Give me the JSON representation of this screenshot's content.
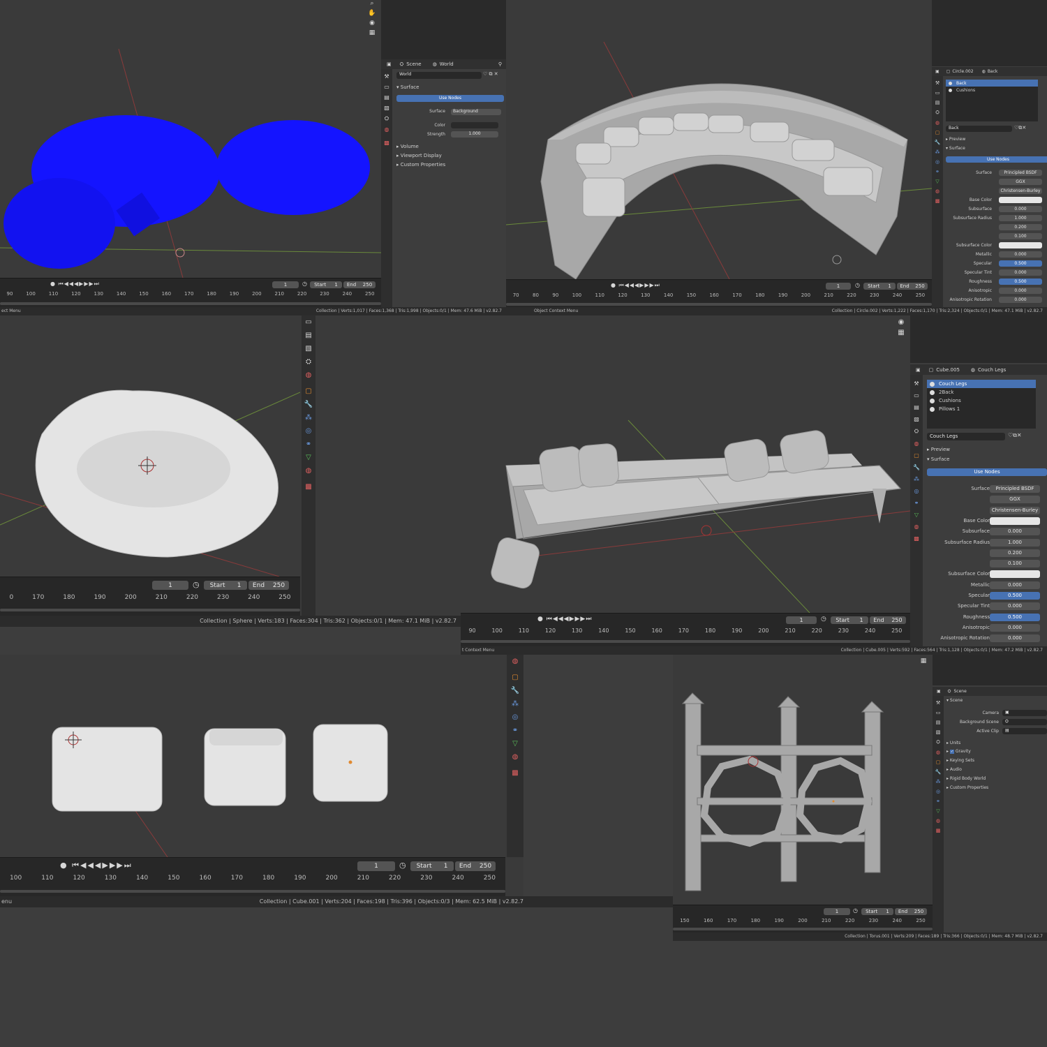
{
  "colors": {
    "blue_mesh": "#1414ff",
    "accent": "#4772b3",
    "mesh_grey": "#a8a8a8",
    "mesh_white": "#e4e4e4"
  },
  "p1": {
    "frame": "1",
    "start_label": "Start",
    "start": "1",
    "end_label": "End",
    "end": "250",
    "ruler": [
      "90",
      "100",
      "110",
      "120",
      "130",
      "140",
      "150",
      "160",
      "170",
      "180",
      "190",
      "200",
      "210",
      "220",
      "230",
      "240",
      "250"
    ],
    "props": {
      "scene_tab": "Scene",
      "world_tab": "World",
      "world_name": "World",
      "surface_section": "Surface",
      "use_nodes": "Use Nodes",
      "surface_label": "Surface",
      "surface_value": "Background",
      "color_label": "Color",
      "strength_label": "Strength",
      "strength_value": "1.000",
      "volume": "Volume",
      "viewport_display": "Viewport Display",
      "custom_properties": "Custom Properties"
    },
    "status_left": "ect Menu",
    "status": "Collection | Verts:1,017 | Faces:1,368 | Tris:1,998 | Objects:0/1 | Mem: 47.6 MiB | v2.82.7"
  },
  "p2": {
    "frame": "1",
    "start_label": "Start",
    "start": "1",
    "end_label": "End",
    "end": "250",
    "ruler": [
      "70",
      "80",
      "90",
      "100",
      "110",
      "120",
      "130",
      "140",
      "150",
      "160",
      "170",
      "180",
      "190",
      "200",
      "210",
      "220",
      "230",
      "240",
      "250"
    ],
    "props": {
      "object": "Circle.002",
      "material": "Back",
      "slots": [
        "Back",
        "Cushions"
      ],
      "material_name": "Back",
      "preview": "Preview",
      "surface_section": "Surface",
      "use_nodes": "Use Nodes",
      "rows": [
        {
          "label": "Surface",
          "value": "Principled BSDF",
          "kind": "plain"
        },
        {
          "label": "",
          "value": "GGX",
          "kind": "plain"
        },
        {
          "label": "",
          "value": "Christensen-Burley",
          "kind": "plain"
        },
        {
          "label": "Base Color",
          "value": "",
          "kind": "white"
        },
        {
          "label": "Subsurface",
          "value": "0.000",
          "kind": "plain"
        },
        {
          "label": "Subsurface Radius",
          "value": "1.000",
          "kind": "plain"
        },
        {
          "label": "",
          "value": "0.200",
          "kind": "plain"
        },
        {
          "label": "",
          "value": "0.100",
          "kind": "plain"
        },
        {
          "label": "Subsurface Color",
          "value": "",
          "kind": "white"
        },
        {
          "label": "Metallic",
          "value": "0.000",
          "kind": "plain"
        },
        {
          "label": "Specular",
          "value": "0.500",
          "kind": "blue"
        },
        {
          "label": "Specular Tint",
          "value": "0.000",
          "kind": "plain"
        },
        {
          "label": "Roughness",
          "value": "0.500",
          "kind": "blue"
        },
        {
          "label": "Anisotropic",
          "value": "0.000",
          "kind": "plain"
        },
        {
          "label": "Anisotropic Rotation",
          "value": "0.000",
          "kind": "plain"
        }
      ]
    },
    "status_left": "Object Context Menu",
    "status": "Collection | Circle.002 | Verts:1,222 | Faces:1,170 | Tris:2,324 | Objects:0/1 | Mem: 47.1 MiB | v2.82.7"
  },
  "p3": {
    "frame": "1",
    "start_label": "Start",
    "start": "1",
    "end_label": "End",
    "end": "250",
    "ruler": [
      "0",
      "170",
      "180",
      "190",
      "200",
      "210",
      "220",
      "230",
      "240",
      "250"
    ],
    "status": "Collection | Sphere | Verts:183 | Faces:304 | Tris:362 | Objects:0/1 | Mem: 47.1 MiB | v2.82.7"
  },
  "p4": {
    "frame": "1",
    "start_label": "Start",
    "start": "1",
    "end_label": "End",
    "end": "250",
    "ruler": [
      "90",
      "100",
      "110",
      "120",
      "130",
      "140",
      "150",
      "160",
      "170",
      "180",
      "190",
      "200",
      "210",
      "220",
      "230",
      "240",
      "250"
    ],
    "props": {
      "object": "Cube.005",
      "material": "Couch Legs",
      "slots": [
        "Couch Legs",
        "2Back",
        "Cushions",
        "Pillows 1"
      ],
      "material_name": "Couch Legs",
      "preview": "Preview",
      "surface_section": "Surface",
      "use_nodes": "Use Nodes",
      "rows": [
        {
          "label": "Surface",
          "value": "Principled BSDF",
          "kind": "plain"
        },
        {
          "label": "",
          "value": "GGX",
          "kind": "plain"
        },
        {
          "label": "",
          "value": "Christensen-Burley",
          "kind": "plain"
        },
        {
          "label": "Base Color",
          "value": "",
          "kind": "white"
        },
        {
          "label": "Subsurface",
          "value": "0.000",
          "kind": "plain"
        },
        {
          "label": "Subsurface Radius",
          "value": "1.000",
          "kind": "plain"
        },
        {
          "label": "",
          "value": "0.200",
          "kind": "plain"
        },
        {
          "label": "",
          "value": "0.100",
          "kind": "plain"
        },
        {
          "label": "Subsurface Color",
          "value": "",
          "kind": "white"
        },
        {
          "label": "Metallic",
          "value": "0.000",
          "kind": "plain"
        },
        {
          "label": "Specular",
          "value": "0.500",
          "kind": "blue"
        },
        {
          "label": "Specular Tint",
          "value": "0.000",
          "kind": "plain"
        },
        {
          "label": "Roughness",
          "value": "0.500",
          "kind": "blue"
        },
        {
          "label": "Anisotropic",
          "value": "0.000",
          "kind": "plain"
        },
        {
          "label": "Anisotropic Rotation",
          "value": "0.000",
          "kind": "plain"
        }
      ]
    },
    "status_left": "t Context Menu",
    "status": "Collection | Cube.005 | Verts:592 | Faces:564 | Tris:1,128 | Objects:0/1 | Mem: 47.2 MiB | v2.82.7"
  },
  "p5": {
    "frame": "1",
    "start_label": "Start",
    "start": "1",
    "end_label": "End",
    "end": "250",
    "ruler": [
      "100",
      "110",
      "120",
      "130",
      "140",
      "150",
      "160",
      "170",
      "180",
      "190",
      "200",
      "210",
      "220",
      "230",
      "240",
      "250"
    ],
    "status_left": "enu",
    "status": "Collection | Cube.001 | Verts:204 | Faces:198 | Tris:396 | Objects:0/3 | Mem: 62.5 MiB | v2.82.7"
  },
  "p6": {
    "frame": "1",
    "start_label": "Start",
    "start": "1",
    "end_label": "End",
    "end": "250",
    "ruler": [
      "150",
      "160",
      "170",
      "180",
      "190",
      "200",
      "210",
      "220",
      "230",
      "240",
      "250"
    ],
    "props": {
      "scene_tab": "Scene",
      "scene_section": "Scene",
      "camera": "Camera",
      "background_scene": "Background Scene",
      "active_clip": "Active Clip",
      "units": "Units",
      "gravity": "Gravity",
      "keying_sets": "Keying Sets",
      "audio": "Audio",
      "rigid_body_world": "Rigid Body World",
      "custom_properties": "Custom Properties"
    },
    "status": "Collection | Torus.001 | Verts:209 | Faces:189 | Tris:366 | Objects:0/1 | Mem: 48.7 MiB | v2.82.7"
  }
}
